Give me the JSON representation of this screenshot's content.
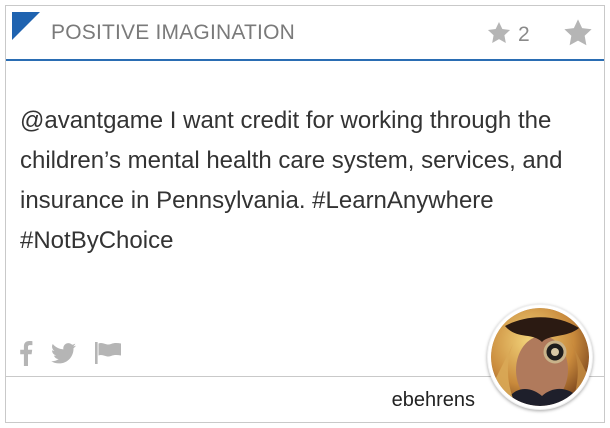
{
  "card": {
    "type_label": "POSITIVE IMAGINATION",
    "star_count": "2",
    "body": "@avantgame I want credit for working through the children’s mental health care system, services, and insurance in Pennsylvania. #LearnAnywhere #NotByChoice",
    "author": "ebehrens"
  },
  "icons": {
    "corner": "card-type-corner-icon",
    "star_count": "star-icon",
    "star_button": "star-icon",
    "share": [
      "facebook-icon",
      "twitter-icon",
      "flag-icon"
    ]
  },
  "colors": {
    "accent": "#1f63b0",
    "header_rule": "#2a6db3",
    "muted_icon": "#b5b5b5",
    "text": "#333333"
  }
}
